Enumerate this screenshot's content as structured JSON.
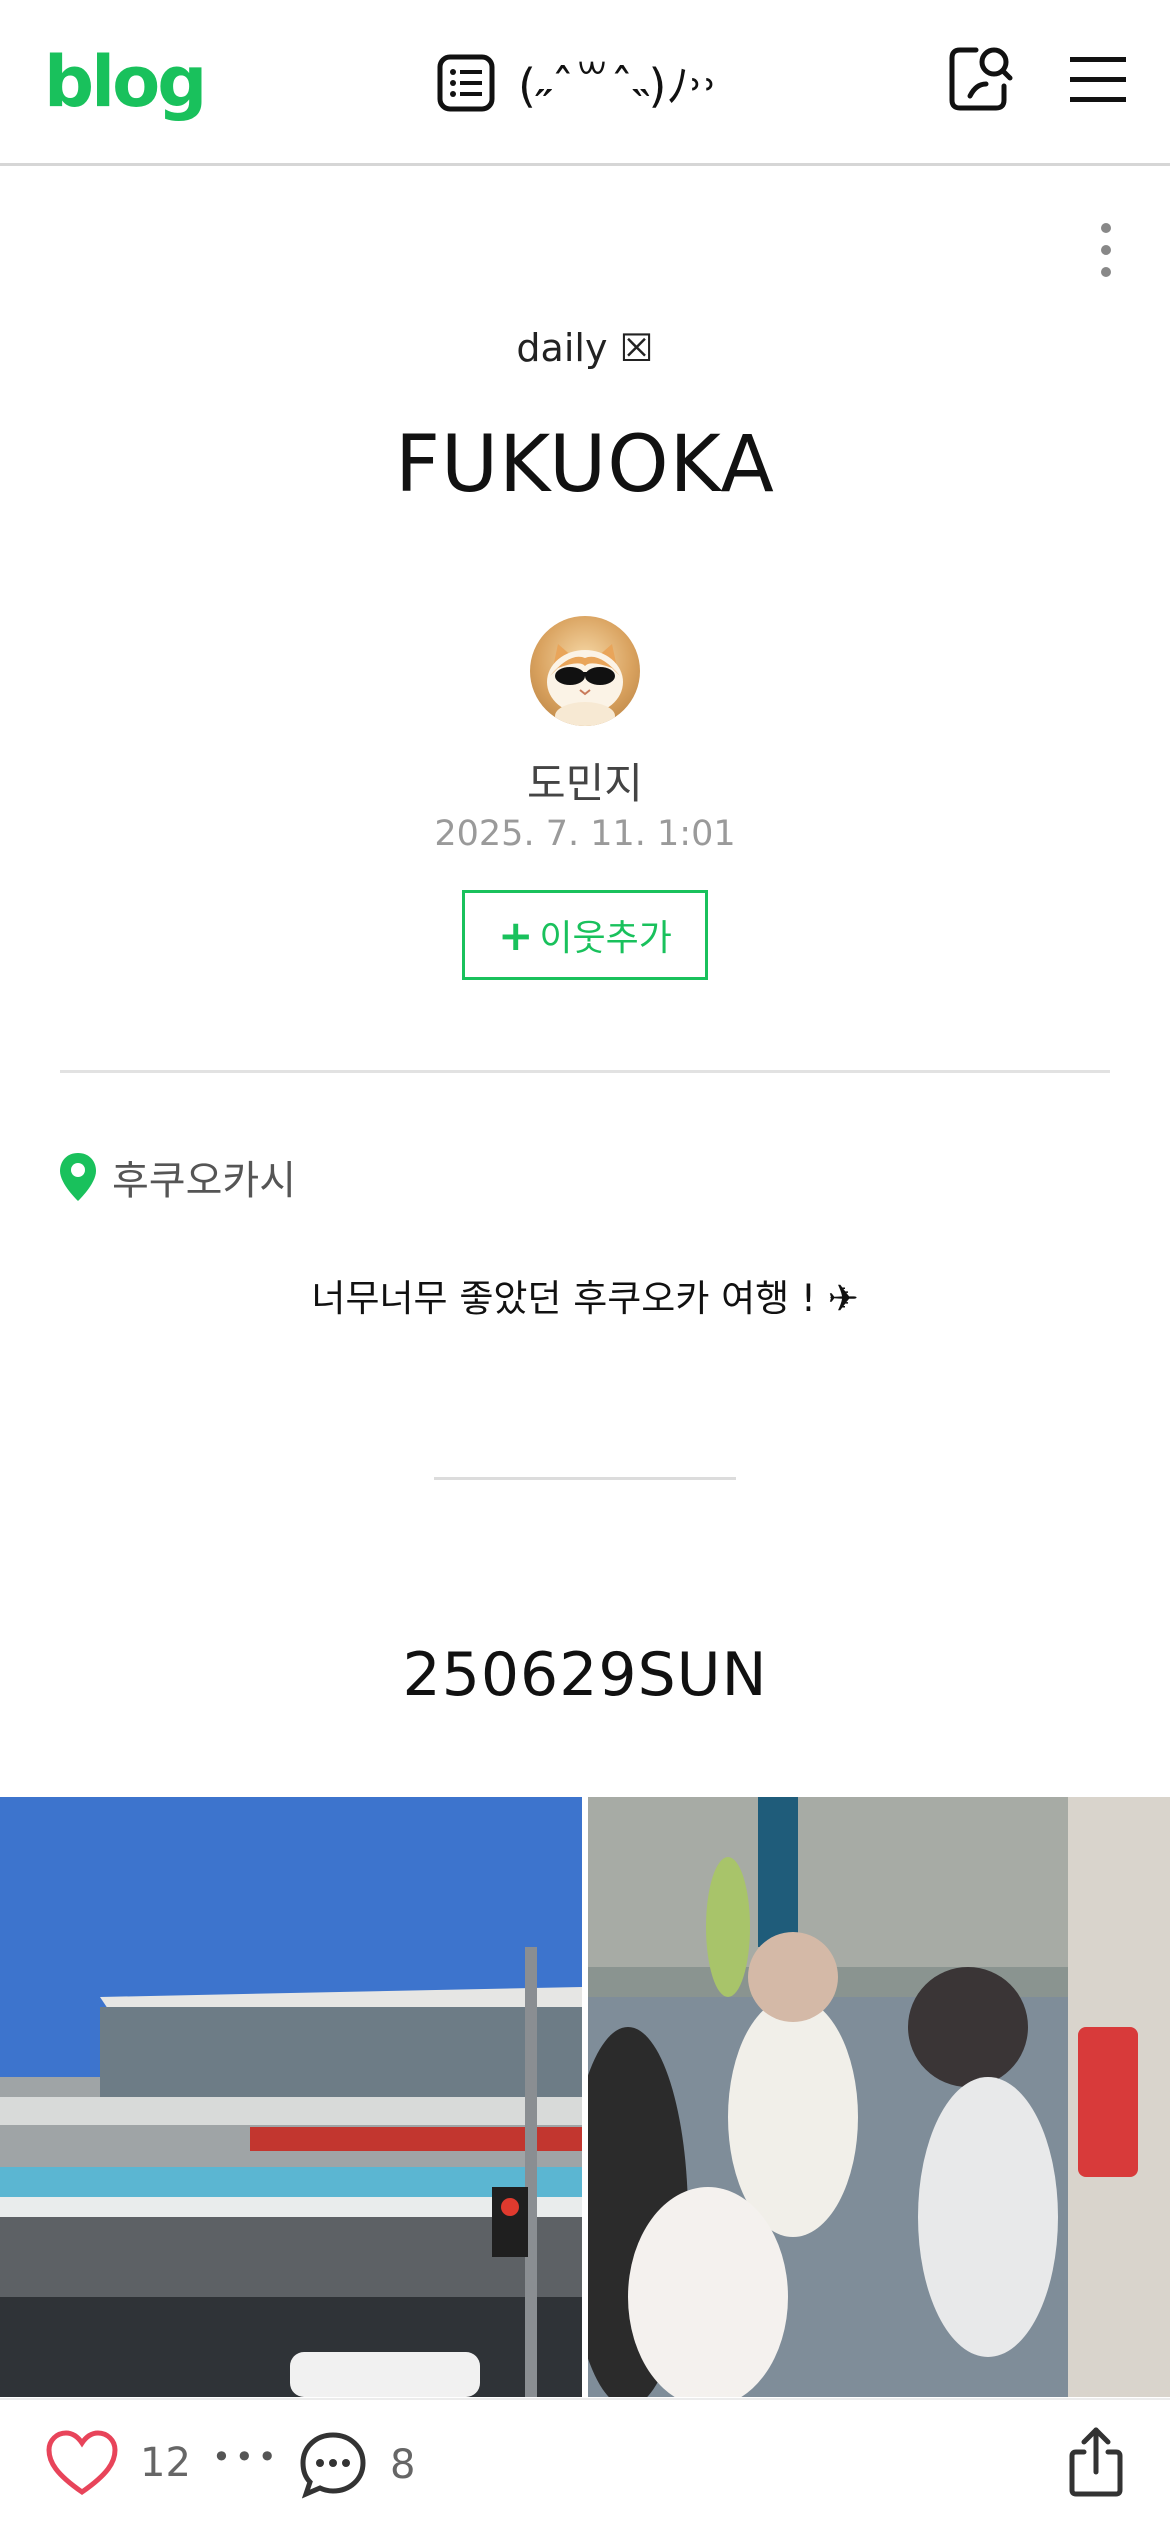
{
  "header": {
    "logo": "blog",
    "blog_title": "(˶ˆ꒳ˆ˵)ﾉ˒˒",
    "list_icon": "list-icon",
    "search_icon": "search-icon",
    "menu_icon": "hamburger-menu-icon"
  },
  "post": {
    "category": "daily ☒",
    "title": "FUKUOKA",
    "author": "도민지",
    "date": "2025. 7. 11. 1:01",
    "follow_plus": "+",
    "follow_label": "이웃추가",
    "location": "후쿠오카시",
    "intro": "너무너무 좋았던 후쿠오카 여행 ! ✈",
    "section_title": "250629SUN"
  },
  "photos": {
    "left": "airport-terminal-photo",
    "right": "people-at-station-photo"
  },
  "bottom_bar": {
    "like_count": "12",
    "more_dots": "•••",
    "comment_count": "8"
  },
  "colors": {
    "brand_green": "#19c15c",
    "like_pink": "#e8445a"
  }
}
